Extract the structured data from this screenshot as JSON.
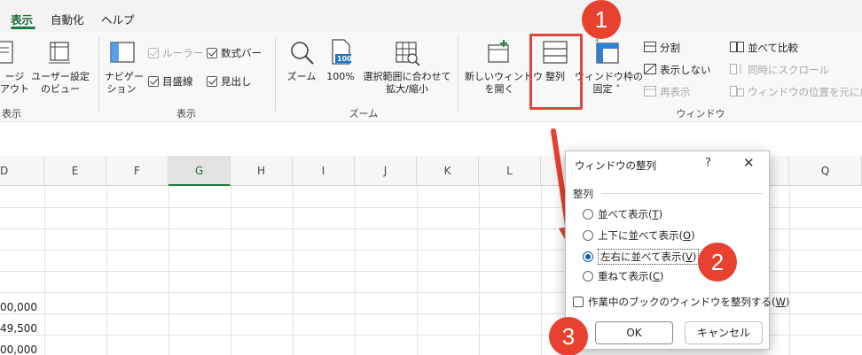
{
  "menu": {
    "tabs": [
      {
        "label": "表示",
        "active": true
      },
      {
        "label": "自動化"
      },
      {
        "label": "ヘルプ"
      }
    ]
  },
  "ribbon": {
    "workbook_views": {
      "page_layout_label_1": "ージ",
      "page_layout_label_2": "アウト",
      "custom_view_label_1": "ユーザー設定",
      "custom_view_label_2": "のビュー",
      "group_label": "表示"
    },
    "show": {
      "navigation_label_1": "ナビゲー",
      "navigation_label_2": "ション",
      "ruler": {
        "label": "ルーラー",
        "checked": true,
        "disabled": true
      },
      "gridlines": {
        "label": "目盛線",
        "checked": true
      },
      "formula_bar": {
        "label": "数式バー",
        "checked": true
      },
      "headings": {
        "label": "見出し",
        "checked": true
      },
      "group_label": "表示"
    },
    "zoom": {
      "zoom_label": "ズーム",
      "zoom100_label": "100%",
      "zoom100_icon_text": "100",
      "zoom_selection_label_1": "選択範囲に合わせて",
      "zoom_selection_label_2": "拡大/縮小",
      "group_label": "ズーム"
    },
    "window": {
      "new_window_label_1": "新しいウィンドウ",
      "new_window_label_2": "を開く",
      "arrange_label": "整列",
      "freeze_label_1": "ウィンドウ枠の",
      "freeze_label_2": "固定 ˅",
      "split_label": "分割",
      "hide_label": "表示しない",
      "unhide_label": "再表示",
      "side_by_side_label": "並べて比較",
      "sync_scroll_label": "同時にスクロール",
      "reset_position_label": "ウィンドウの位置を元に戻す",
      "group_label": "ウィンドウ"
    }
  },
  "grid": {
    "columns": [
      "D",
      "E",
      "F",
      "G",
      "H",
      "I",
      "J",
      "K",
      "L",
      "Q"
    ],
    "selected_column": "G",
    "values": [
      "00,000",
      "49,500",
      "00,000"
    ]
  },
  "dialog": {
    "title": "ウィンドウの整列",
    "help_glyph": "?",
    "close_glyph": "✕",
    "section_label": "整列",
    "options": [
      {
        "text": "並べて表示(",
        "key": "T",
        "end": ")",
        "selected": false
      },
      {
        "text": "上下に並べて表示(",
        "key": "O",
        "end": ")",
        "selected": false
      },
      {
        "text": "左右に並べて表示(",
        "key": "V",
        "end": ")",
        "selected": true
      },
      {
        "text": "重ねて表示(",
        "key": "C",
        "end": ")",
        "selected": false
      }
    ],
    "active_workbook": {
      "text": "作業中のブックのウィンドウを整列する(",
      "key": "W",
      "end": ")",
      "checked": false
    },
    "ok_label": "OK",
    "cancel_label": "キャンセル"
  },
  "annotations": {
    "step1": "1",
    "step2": "2",
    "step3": "3",
    "color": "#e8412f"
  }
}
